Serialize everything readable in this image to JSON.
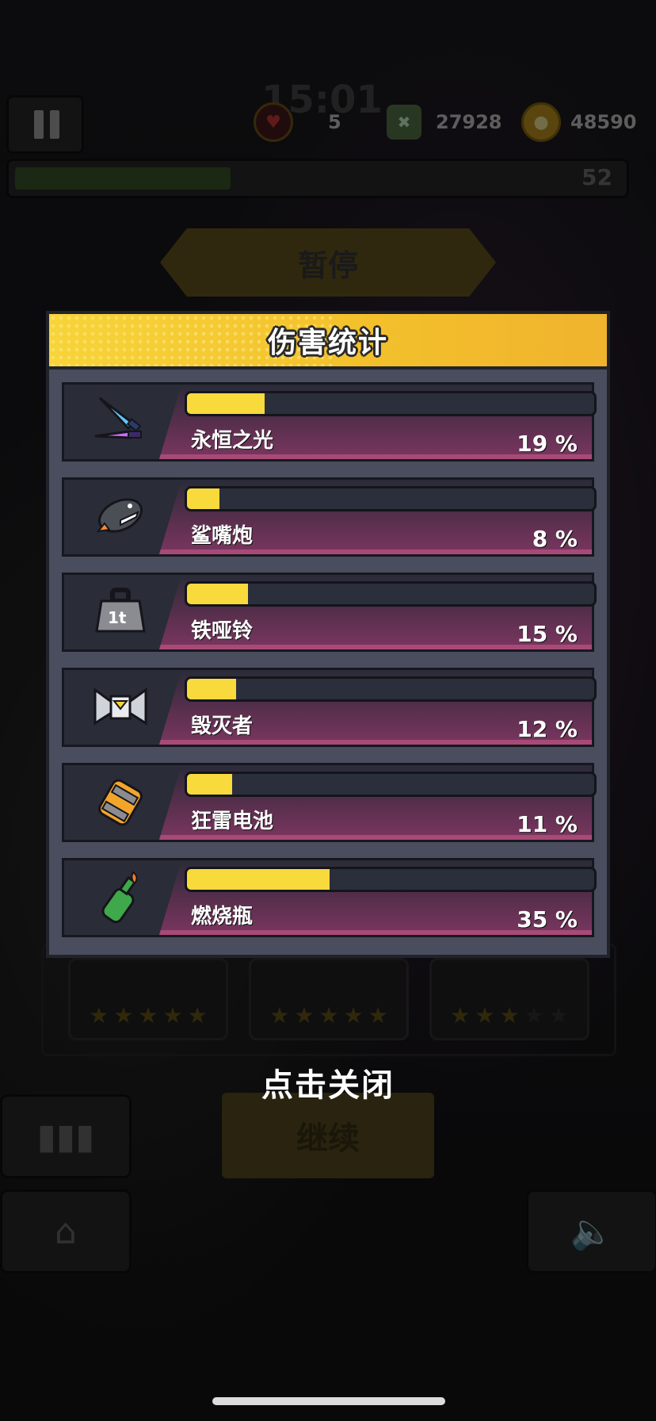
{
  "hud": {
    "timer": "15:01",
    "lives": "5",
    "kills": "27928",
    "coins": "48590",
    "level": "52"
  },
  "pause_title": "暂停",
  "damage_panel": {
    "title": "伤害统计",
    "weapons": [
      {
        "name": "永恒之光",
        "percent_label": "19 %",
        "percent": 19,
        "icon": "dual-glow-swords-icon"
      },
      {
        "name": "鲨嘴炮",
        "percent_label": "8 %",
        "percent": 8,
        "icon": "shark-rocket-icon"
      },
      {
        "name": "铁哑铃",
        "percent_label": "15 %",
        "percent": 15,
        "icon": "iron-weight-icon"
      },
      {
        "name": "毁灭者",
        "percent_label": "12 %",
        "percent": 12,
        "icon": "destroyer-drone-icon"
      },
      {
        "name": "狂雷电池",
        "percent_label": "11 %",
        "percent": 11,
        "icon": "thunder-battery-icon"
      },
      {
        "name": "燃烧瓶",
        "percent_label": "35 %",
        "percent": 35,
        "icon": "molotov-bottle-icon"
      }
    ]
  },
  "slots": [
    {
      "stars_filled": 5,
      "stars_total": 5
    },
    {
      "stars_filled": 5,
      "stars_total": 5
    },
    {
      "stars_filled": 3,
      "stars_total": 5
    }
  ],
  "close_hint": "点击关闭",
  "continue_label": "继续",
  "colors": {
    "bar_fill": "#f8da3c",
    "header": "#f3c12c",
    "panel": "#4a4d5e"
  }
}
